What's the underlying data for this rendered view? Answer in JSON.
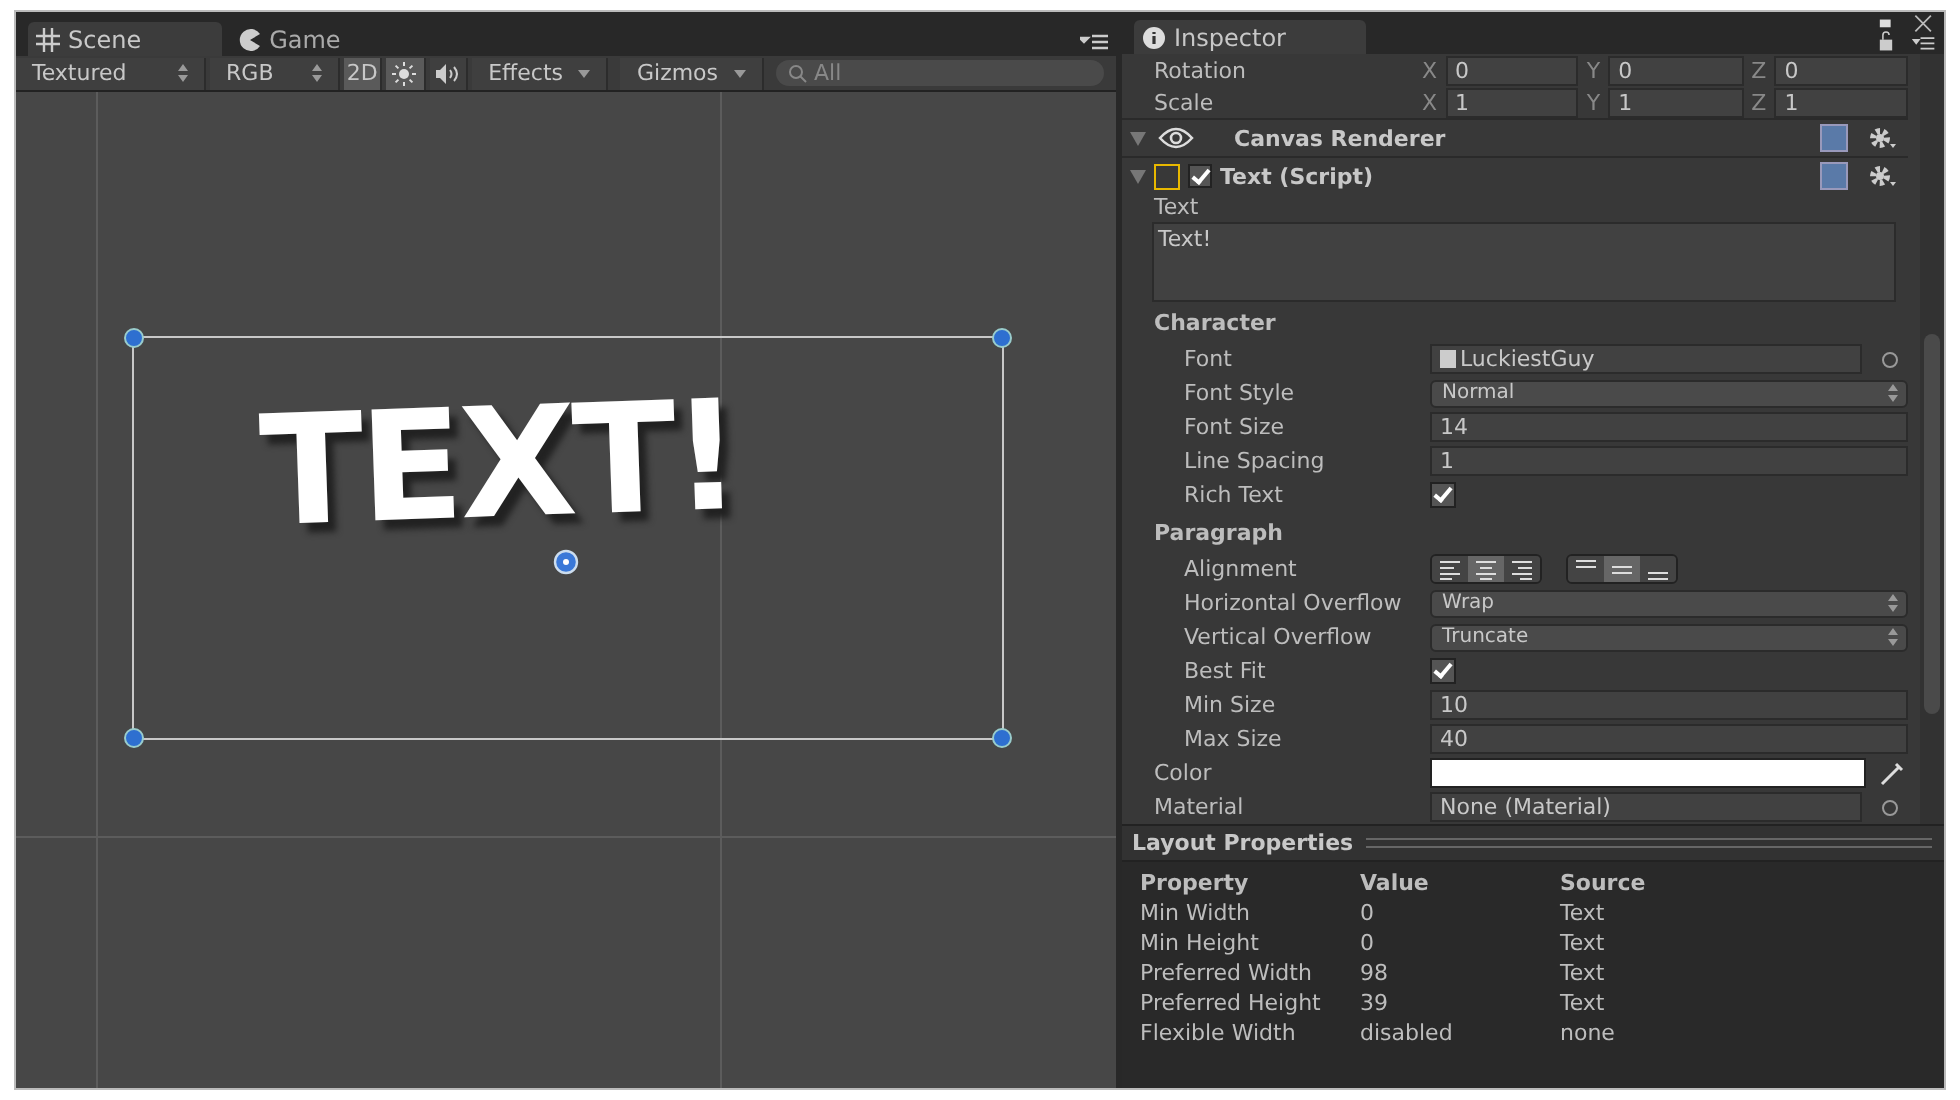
{
  "scene_view": {
    "tabs": [
      {
        "label": "Scene",
        "kind": "scene",
        "selected": true
      },
      {
        "label": "Game",
        "kind": "game",
        "selected": false
      }
    ],
    "toolbar": {
      "shading": "Textured",
      "channel": "RGB",
      "toggles": [
        {
          "kind": "mode",
          "label": "2D",
          "on": true
        },
        {
          "kind": "lighting",
          "on": true
        },
        {
          "kind": "audio",
          "on": false
        }
      ],
      "effects": "Effects",
      "gizmos": "Gizmos",
      "search": {
        "placeholder": "All"
      }
    },
    "scene_text": "TEXT!"
  },
  "inspector": {
    "tab": "Inspector",
    "transform_rows": [
      {
        "label": "Rotation",
        "axes": [
          {
            "axis": "X",
            "value": "0"
          },
          {
            "axis": "Y",
            "value": "0"
          },
          {
            "axis": "Z",
            "value": "0"
          }
        ]
      },
      {
        "label": "Scale",
        "axes": [
          {
            "axis": "X",
            "value": "1"
          },
          {
            "axis": "Y",
            "value": "1"
          },
          {
            "axis": "Z",
            "value": "1"
          }
        ]
      }
    ],
    "canvas_renderer": {
      "title": "Canvas Renderer"
    },
    "text_component": {
      "title": "Text (Script)",
      "enabled": true,
      "text_label": "Text",
      "text_value": "Text!",
      "properties": [
        {
          "kind": "section",
          "label": "Character",
          "children": [
            {
              "kind": "object",
              "label": "Font",
              "value": "LuckiestGuy"
            },
            {
              "kind": "dropdown",
              "label": "Font Style",
              "value": "Normal"
            },
            {
              "kind": "field",
              "label": "Font Size",
              "value": "14"
            },
            {
              "kind": "field",
              "label": "Line Spacing",
              "value": "1"
            },
            {
              "kind": "checkbox",
              "label": "Rich Text",
              "checked": true
            }
          ]
        },
        {
          "kind": "section",
          "label": "Paragraph",
          "children": [
            {
              "kind": "alignment",
              "label": "Alignment",
              "horizontal": [
                {
                  "selected": false
                },
                {
                  "selected": true
                },
                {
                  "selected": false
                }
              ],
              "vertical": [
                {
                  "selected": false
                },
                {
                  "selected": true
                },
                {
                  "selected": false
                }
              ]
            },
            {
              "kind": "dropdown",
              "label": "Horizontal Overflow",
              "value": "Wrap"
            },
            {
              "kind": "dropdown",
              "label": "Vertical Overflow",
              "value": "Truncate"
            },
            {
              "kind": "checkbox",
              "label": "Best Fit",
              "checked": true
            },
            {
              "kind": "field",
              "label": "Min Size",
              "value": "10"
            },
            {
              "kind": "field",
              "label": "Max Size",
              "value": "40"
            }
          ]
        },
        {
          "kind": "color",
          "label": "Color",
          "color": "#ffffff"
        },
        {
          "kind": "object",
          "label": "Material",
          "value": "None (Material)"
        }
      ]
    }
  },
  "layout_properties": {
    "title": "Layout Properties",
    "columns": [
      "Property",
      "Value",
      "Source"
    ],
    "rows": [
      [
        "Min Width",
        "0",
        "Text"
      ],
      [
        "Min Height",
        "0",
        "Text"
      ],
      [
        "Preferred Width",
        "98",
        "Text"
      ],
      [
        "Preferred Height",
        "39",
        "Text"
      ],
      [
        "Flexible Width",
        "disabled",
        "none"
      ]
    ]
  }
}
